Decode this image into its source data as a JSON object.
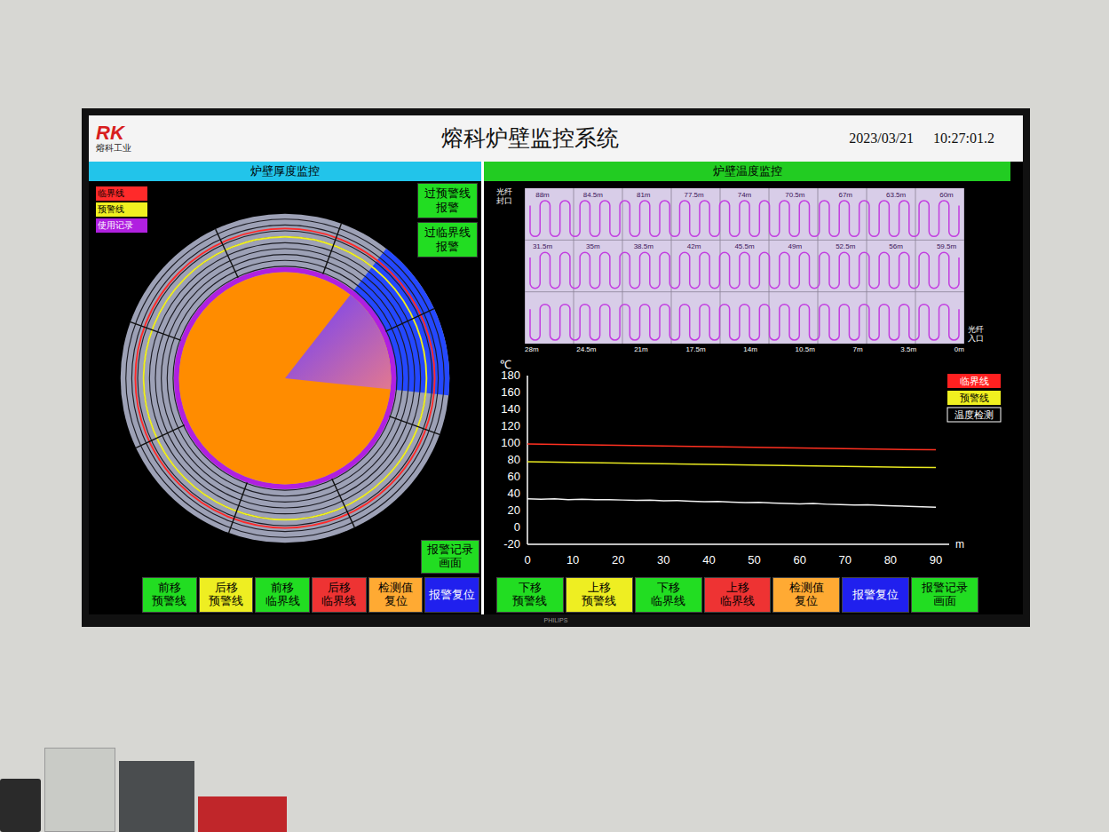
{
  "tv": {
    "brand": "PHILIPS"
  },
  "header": {
    "logo_mark": "RK",
    "logo_text": "熔科工业",
    "title": "熔科炉壁监控系统",
    "date": "2023/03/21",
    "time": "10:27:01.2"
  },
  "thickness_panel": {
    "title": "炉壁厚度监控",
    "legend": [
      {
        "label": "临界线",
        "color": "#ff2a2a"
      },
      {
        "label": "预警线",
        "color": "#f0f020"
      },
      {
        "label": "使用记录",
        "color": "#b020e0"
      }
    ],
    "alarms": [
      {
        "label": "过预警线报警",
        "active": false
      },
      {
        "label": "过临界线报警",
        "active": false
      }
    ],
    "furnace": {
      "critical_level": 0.91,
      "warning_level": 0.86,
      "usage_level": 0.66,
      "scan_from_deg": -52,
      "scan_to_deg": 6
    },
    "record_button": {
      "lines": [
        "报警记录",
        "画面"
      ],
      "color": "#22dd22"
    },
    "buttons": [
      {
        "lines": [
          "前移",
          "预警线"
        ],
        "color": "#22dd22"
      },
      {
        "lines": [
          "后移",
          "预警线"
        ],
        "color": "#eeee22"
      },
      {
        "lines": [
          "前移",
          "临界线"
        ],
        "color": "#22dd22"
      },
      {
        "lines": [
          "后移",
          "临界线"
        ],
        "color": "#ee3333"
      },
      {
        "lines": [
          "检测值",
          "复位"
        ],
        "color": "#ffaa33"
      },
      {
        "lines": [
          "报警复位"
        ],
        "color": "#2020ee"
      }
    ]
  },
  "temperature_panel": {
    "title": "炉壁温度监控",
    "fiber": {
      "seal_label": "光纤封口",
      "entry_label": "光纤入口",
      "row_labels": [
        [
          "88m",
          "84.5m",
          "81m",
          "77.5m",
          "74m",
          "70.5m",
          "67m",
          "63.5m",
          "60m"
        ],
        [
          "31.5m",
          "35m",
          "38.5m",
          "42m",
          "45.5m",
          "49m",
          "52.5m",
          "56m",
          "59.5m"
        ]
      ],
      "axis_labels": [
        "28m",
        "24.5m",
        "21m",
        "17.5m",
        "14m",
        "10.5m",
        "7m",
        "3.5m",
        "0m"
      ]
    },
    "chart": {
      "y_unit": "℃",
      "x_unit": "m",
      "y_ticks": [
        "180",
        "160",
        "140",
        "120",
        "100",
        "80",
        "60",
        "40",
        "20",
        "0",
        "-20"
      ],
      "x_ticks": [
        "0",
        "10",
        "20",
        "30",
        "40",
        "50",
        "60",
        "70",
        "80",
        "90"
      ],
      "legend": [
        {
          "label": "临界线",
          "color": "#ff2020",
          "kind": "filled"
        },
        {
          "label": "预警线",
          "color": "#f0f020",
          "kind": "filled"
        },
        {
          "label": "温度检测",
          "color": "#ffffff",
          "kind": "outlined"
        }
      ],
      "series": [
        {
          "name": "临界线",
          "color": "#ff3020",
          "values": [
            99,
            98.2,
            97.4,
            96.6,
            95.8,
            95,
            94.2,
            93.4,
            92.6,
            92
          ]
        },
        {
          "name": "预警线",
          "color": "#e8e820",
          "values": [
            78,
            77.2,
            76.4,
            75.6,
            74.8,
            74,
            73.2,
            72.4,
            71.6,
            71
          ]
        },
        {
          "name": "温度检测",
          "color": "#f0f0f0",
          "values": [
            34,
            33.5,
            34,
            33,
            33.5,
            32.8,
            33,
            32.5,
            32,
            32.3,
            31.5,
            31.8,
            31,
            30.5,
            30.8,
            30,
            29.5,
            29.8,
            29,
            28.5,
            28,
            28.3,
            27.5,
            27,
            26.5,
            26.8,
            26,
            25.5,
            25,
            24.5,
            24
          ]
        }
      ]
    },
    "buttons": [
      {
        "lines": [
          "下移",
          "预警线"
        ],
        "color": "#22dd22"
      },
      {
        "lines": [
          "上移",
          "预警线"
        ],
        "color": "#eeee22"
      },
      {
        "lines": [
          "下移",
          "临界线"
        ],
        "color": "#22dd22"
      },
      {
        "lines": [
          "上移",
          "临界线"
        ],
        "color": "#ee3333"
      },
      {
        "lines": [
          "检测值",
          "复位"
        ],
        "color": "#ffaa33"
      },
      {
        "lines": [
          "报警复位"
        ],
        "color": "#2020ee"
      },
      {
        "lines": [
          "报警记录",
          "画面"
        ],
        "color": "#22dd22"
      }
    ]
  }
}
